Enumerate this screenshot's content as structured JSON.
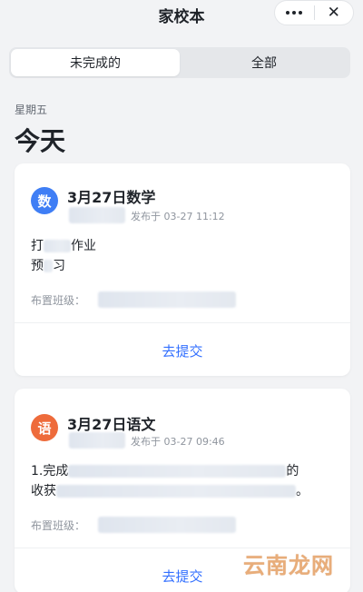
{
  "nav": {
    "title": "家校本",
    "more_icon": "more-dots-icon",
    "close_icon": "close-icon",
    "close_glyph": "✕"
  },
  "tabs": [
    {
      "label": "未完成的",
      "active": true
    },
    {
      "label": "全部",
      "active": false
    }
  ],
  "section": {
    "weekday": "星期五",
    "day_label": "今天"
  },
  "cards": [
    {
      "avatar": "数",
      "avatar_color": "#3f7ef5",
      "title": "3月27日数学",
      "published": "发布于 03-27 11:12",
      "content_line1": "打",
      "content_line1_tail": "作业",
      "content_line2": "预",
      "content_line2_tail": "习",
      "class_label": "布置班级：",
      "action": "去提交"
    },
    {
      "avatar": "语",
      "avatar_color": "#ee6b3b",
      "title": "3月27日语文",
      "published": "发布于 03-27 09:46",
      "content_line1": "1.完成",
      "content_line1_tail": "的",
      "content_line2": "收获",
      "content_line2_tail": "。",
      "class_label": "布置班级：",
      "action": "去提交"
    }
  ],
  "watermark": "云南龙网"
}
